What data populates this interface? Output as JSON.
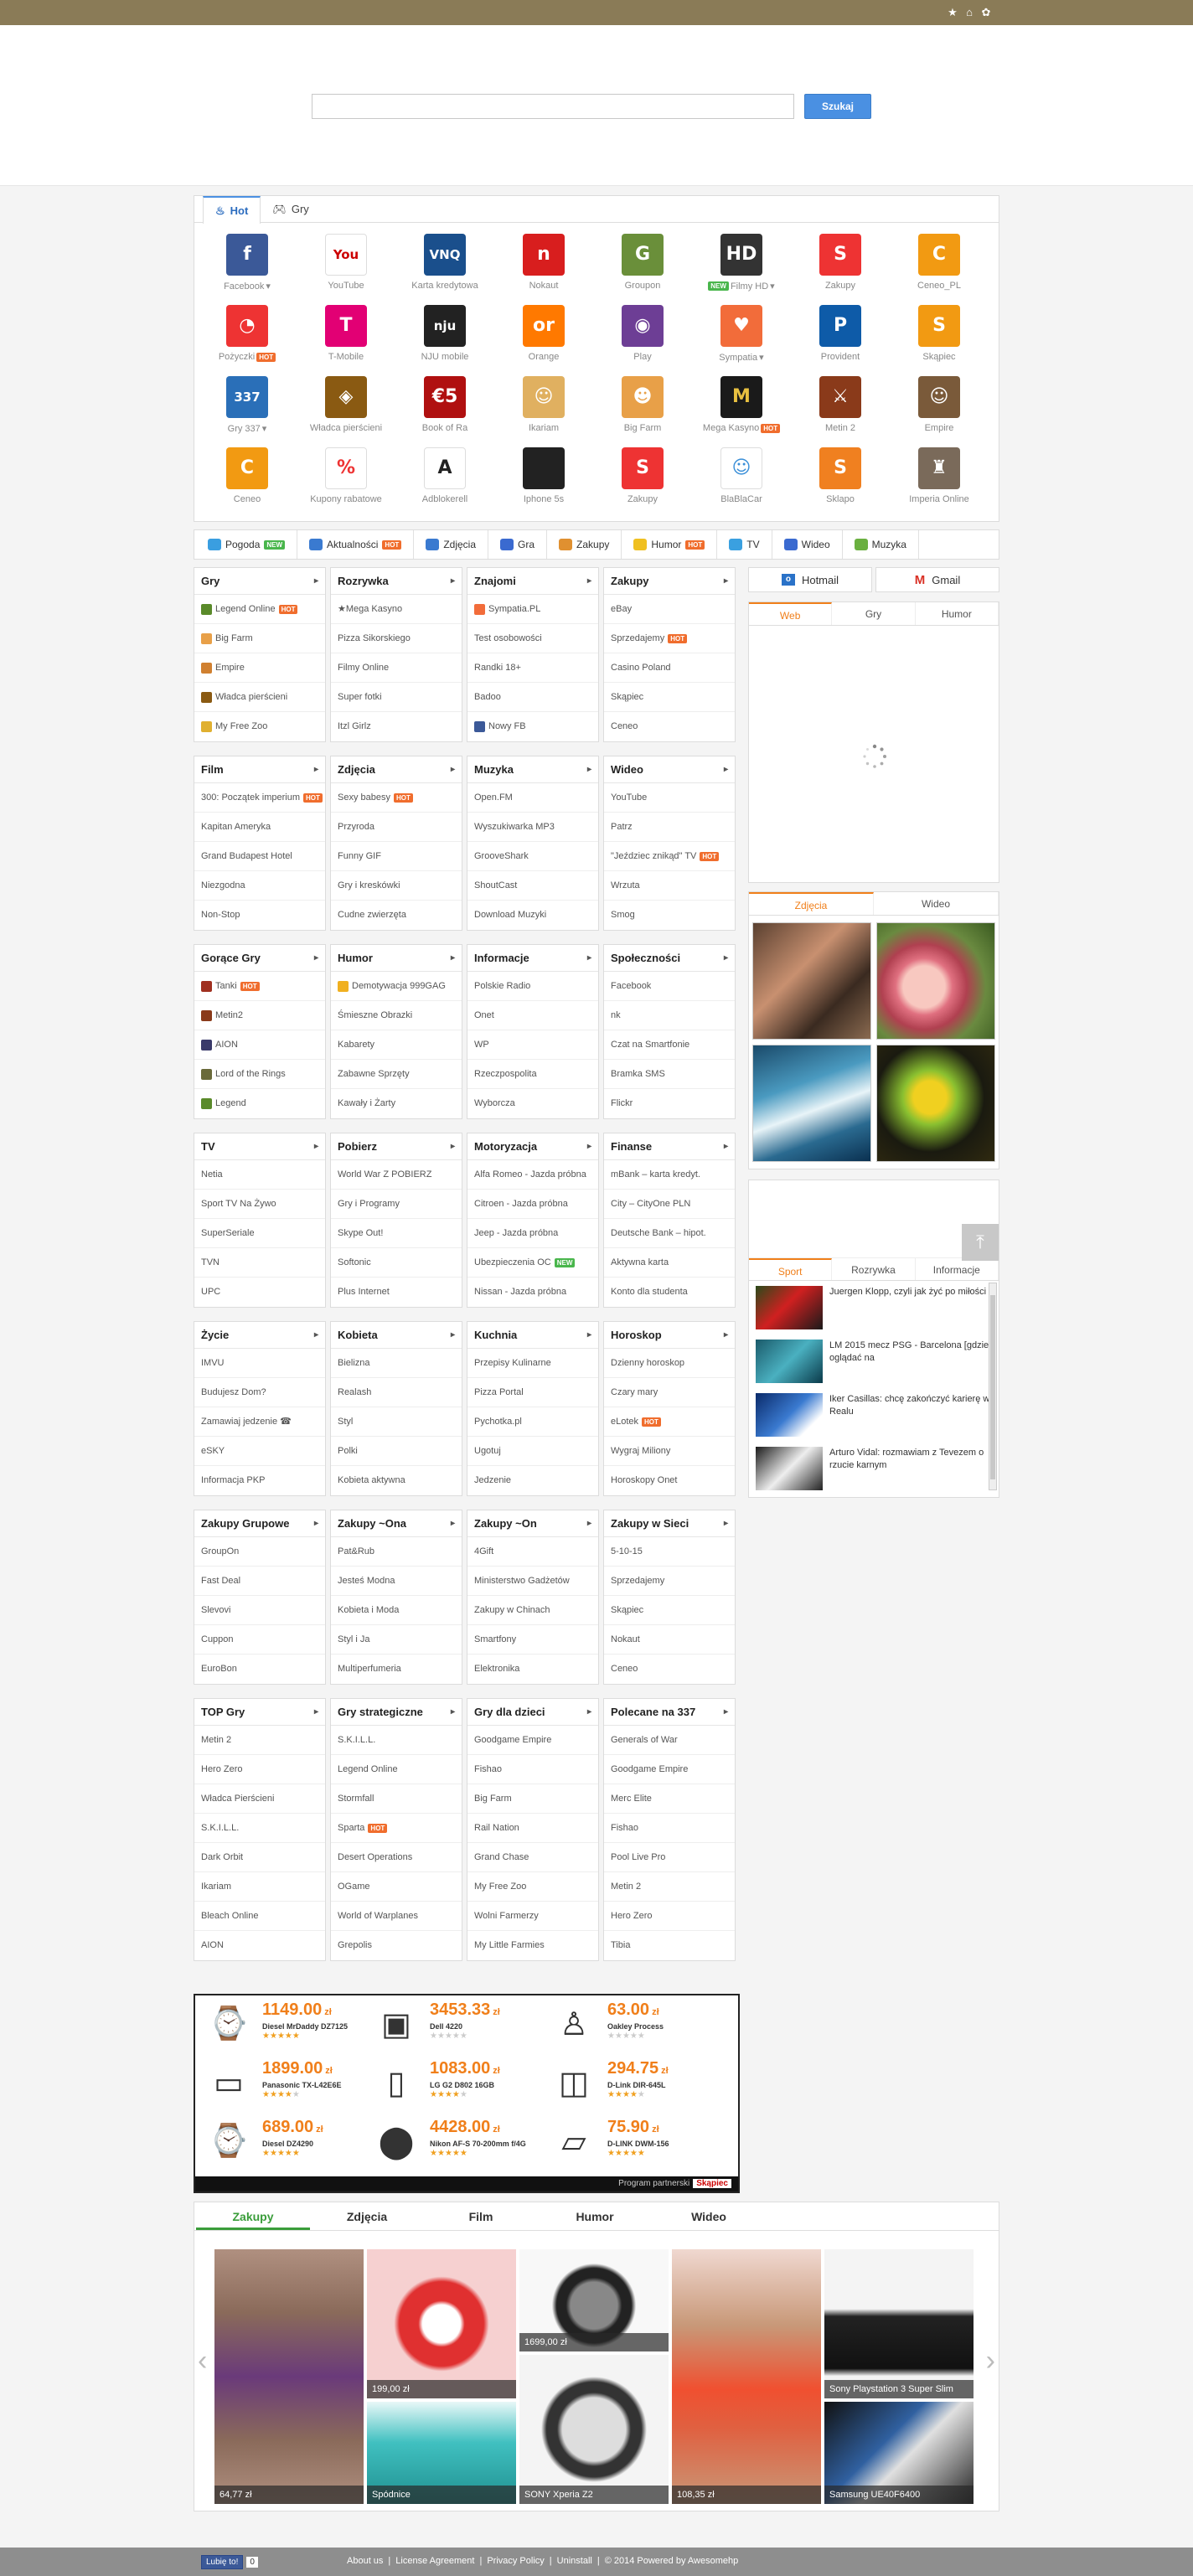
{
  "search": {
    "placeholder": "",
    "button": "Szukaj"
  },
  "icon_tabs": [
    {
      "label": "Hot",
      "icon": "flame-icon"
    },
    {
      "label": "Gry",
      "icon": "gamepad-icon"
    }
  ],
  "icons": [
    {
      "label": "Facebook",
      "caret": true,
      "bg": "#3b5998",
      "glyph": "f"
    },
    {
      "label": "YouTube",
      "bg": "#fff",
      "glyph": "You",
      "fg": "#c00"
    },
    {
      "label": "Karta kredytowa",
      "bg": "#1a4f8c",
      "glyph": "VNQ"
    },
    {
      "label": "Nokaut",
      "bg": "#d81e1e",
      "glyph": "n"
    },
    {
      "label": "Groupon",
      "bg": "#6a8f3a",
      "glyph": "G"
    },
    {
      "label": "Filmy HD",
      "caret": true,
      "badge": "new",
      "bg": "#333",
      "glyph": "HD"
    },
    {
      "label": "Zakupy",
      "bg": "#e33",
      "glyph": "S"
    },
    {
      "label": "Ceneo_PL",
      "bg": "#f29a12",
      "glyph": "C"
    },
    {
      "label": "Pożyczki",
      "badge": "hot",
      "bg": "#e33",
      "glyph": "◔"
    },
    {
      "label": "T-Mobile",
      "bg": "#e20074",
      "glyph": "T"
    },
    {
      "label": "NJU mobile",
      "bg": "#222",
      "glyph": "nju"
    },
    {
      "label": "Orange",
      "bg": "#ff7900",
      "glyph": "or"
    },
    {
      "label": "Play",
      "bg": "#6d3e95",
      "glyph": "◉"
    },
    {
      "label": "Sympatia",
      "caret": true,
      "bg": "#f26c3a",
      "glyph": "♥"
    },
    {
      "label": "Provident",
      "bg": "#0e5ba8",
      "glyph": "P"
    },
    {
      "label": "Skąpiec",
      "bg": "#f29a12",
      "glyph": "S"
    },
    {
      "label": "Gry 337",
      "caret": true,
      "bg": "#2a6fb8",
      "glyph": "337"
    },
    {
      "label": "Władca pierścieni",
      "bg": "#8a5a12",
      "glyph": "◈"
    },
    {
      "label": "Book of Ra",
      "bg": "#b01010",
      "glyph": "€5"
    },
    {
      "label": "Ikariam",
      "bg": "#e0b060",
      "glyph": "☺"
    },
    {
      "label": "Big Farm",
      "bg": "#e8a048",
      "glyph": "☻"
    },
    {
      "label": "Mega Kasyno",
      "badge": "hot",
      "bg": "#1a1a1a",
      "glyph": "M",
      "fg": "#e8c040"
    },
    {
      "label": "Metin 2",
      "bg": "#8a3a1a",
      "glyph": "⚔"
    },
    {
      "label": "Empire",
      "bg": "#7a5a3a",
      "glyph": "☺"
    },
    {
      "label": "Ceneo",
      "bg": "#f29a12",
      "glyph": "C"
    },
    {
      "label": "Kupony rabatowe",
      "bg": "#fff",
      "glyph": "%",
      "fg": "#e33"
    },
    {
      "label": "Adblokerell",
      "bg": "#fff",
      "glyph": "A",
      "fg": "#222"
    },
    {
      "label": "Iphone 5s",
      "bg": "#222",
      "glyph": ""
    },
    {
      "label": "Zakupy",
      "bg": "#e33",
      "glyph": "S"
    },
    {
      "label": "BlaBlaCar",
      "bg": "#fff",
      "glyph": "☺",
      "fg": "#3a8fd8"
    },
    {
      "label": "Sklapo",
      "bg": "#f08020",
      "glyph": "S"
    },
    {
      "label": "Imperia Online",
      "bg": "#7a6a5a",
      "glyph": "♜"
    }
  ],
  "cat_tabs": [
    {
      "label": "Pogoda",
      "badge": "new",
      "icon": "weather-icon",
      "color": "#3a9ee0"
    },
    {
      "label": "Aktualności",
      "badge": "hot",
      "icon": "news-icon",
      "color": "#3a7ad0"
    },
    {
      "label": "Zdjęcia",
      "icon": "photo-icon",
      "color": "#3a7ad0"
    },
    {
      "label": "Gra",
      "icon": "gamepad-icon",
      "color": "#3a6ad0"
    },
    {
      "label": "Zakupy",
      "icon": "cart-icon",
      "color": "#e09030"
    },
    {
      "label": "Humor",
      "badge": "hot",
      "icon": "smiley-icon",
      "color": "#f0c020"
    },
    {
      "label": "TV",
      "icon": "tv-icon",
      "color": "#3aa0e0"
    },
    {
      "label": "Wideo",
      "icon": "video-icon",
      "color": "#3a6ad0"
    },
    {
      "label": "Muzyka",
      "icon": "music-icon",
      "color": "#6ab040"
    }
  ],
  "boxes": [
    {
      "title": "Gry",
      "items": [
        {
          "t": "Legend Online",
          "badge": "hot",
          "ic": "#5a8a2a"
        },
        {
          "t": "Big Farm",
          "ic": "#e8a048"
        },
        {
          "t": "Empire",
          "ic": "#d08030"
        },
        {
          "t": "Władca pierścieni",
          "ic": "#8a5a12"
        },
        {
          "t": "My Free Zoo",
          "ic": "#e0b030"
        }
      ]
    },
    {
      "title": "Rozrywka",
      "items": [
        {
          "t": "★Mega Kasyno"
        },
        {
          "t": "Pizza Sikorskiego"
        },
        {
          "t": "Filmy Online"
        },
        {
          "t": "Super fotki"
        },
        {
          "t": "Itzl Girlz"
        }
      ]
    },
    {
      "title": "Znajomi",
      "items": [
        {
          "t": "Sympatia.PL",
          "ic": "#f26c3a"
        },
        {
          "t": "Test osobowości"
        },
        {
          "t": "Randki 18+"
        },
        {
          "t": "Badoo"
        },
        {
          "t": "Nowy FB",
          "ic": "#3b5998"
        }
      ]
    },
    {
      "title": "Zakupy",
      "items": [
        {
          "t": "eBay"
        },
        {
          "t": "Sprzedajemy",
          "badge": "hot"
        },
        {
          "t": "Casino Poland"
        },
        {
          "t": "Skąpiec"
        },
        {
          "t": "Ceneo"
        }
      ]
    },
    {
      "title": "Film",
      "items": [
        {
          "t": "300: Początek imperium",
          "badge": "hot"
        },
        {
          "t": "Kapitan Ameryka"
        },
        {
          "t": "Grand Budapest Hotel"
        },
        {
          "t": "Niezgodna"
        },
        {
          "t": "Non-Stop"
        }
      ]
    },
    {
      "title": "Zdjęcia",
      "items": [
        {
          "t": "Sexy babesy",
          "badge": "hot"
        },
        {
          "t": "Przyroda"
        },
        {
          "t": "Funny GIF"
        },
        {
          "t": "Gry i kreskówki"
        },
        {
          "t": "Cudne zwierzęta"
        }
      ]
    },
    {
      "title": "Muzyka",
      "items": [
        {
          "t": "Open.FM"
        },
        {
          "t": "Wyszukiwarka MP3"
        },
        {
          "t": "GrooveShark"
        },
        {
          "t": "ShoutCast"
        },
        {
          "t": "Download Muzyki"
        }
      ]
    },
    {
      "title": "Wideo",
      "items": [
        {
          "t": "YouTube"
        },
        {
          "t": "Patrz"
        },
        {
          "t": "\"Jeździec znikąd\" TV",
          "badge": "hot"
        },
        {
          "t": "Wrzuta"
        },
        {
          "t": "Smog"
        }
      ]
    },
    {
      "title": "Gorące Gry",
      "items": [
        {
          "t": "Tanki",
          "badge": "hot",
          "ic": "#a03020"
        },
        {
          "t": "Metin2",
          "ic": "#8a3a1a"
        },
        {
          "t": "AION",
          "ic": "#3a3a6a"
        },
        {
          "t": "Lord of the Rings",
          "ic": "#6a6a3a"
        },
        {
          "t": "Legend",
          "ic": "#5a8a2a"
        }
      ]
    },
    {
      "title": "Humor",
      "items": [
        {
          "t": "Demotywacja 999GAG",
          "ic": "#f0b020"
        },
        {
          "t": "Śmieszne Obrazki"
        },
        {
          "t": "Kabarety"
        },
        {
          "t": "Zabawne Sprzęty"
        },
        {
          "t": "Kawały i Żarty"
        }
      ]
    },
    {
      "title": "Informacje",
      "items": [
        {
          "t": "Polskie Radio"
        },
        {
          "t": "Onet"
        },
        {
          "t": "WP"
        },
        {
          "t": "Rzeczpospolita"
        },
        {
          "t": "Wyborcza"
        }
      ]
    },
    {
      "title": "Społeczności",
      "items": [
        {
          "t": "Facebook"
        },
        {
          "t": "nk"
        },
        {
          "t": "Czat na Smartfonie"
        },
        {
          "t": "Bramka SMS"
        },
        {
          "t": "Flickr"
        }
      ]
    },
    {
      "title": "TV",
      "items": [
        {
          "t": "Netia"
        },
        {
          "t": "Sport TV Na Żywo"
        },
        {
          "t": "SuperSeriale"
        },
        {
          "t": "TVN"
        },
        {
          "t": "UPC"
        }
      ]
    },
    {
      "title": "Pobierz",
      "items": [
        {
          "t": "World War Z POBIERZ"
        },
        {
          "t": "Gry i Programy"
        },
        {
          "t": "Skype Out!"
        },
        {
          "t": "Softonic"
        },
        {
          "t": "Plus Internet"
        }
      ]
    },
    {
      "title": "Motoryzacja",
      "items": [
        {
          "t": "Alfa Romeo - Jazda próbna"
        },
        {
          "t": "Citroen - Jazda próbna"
        },
        {
          "t": "Jeep - Jazda próbna"
        },
        {
          "t": "Ubezpieczenia OC",
          "badge": "new"
        },
        {
          "t": "Nissan - Jazda próbna"
        }
      ]
    },
    {
      "title": "Finanse",
      "items": [
        {
          "t": "mBank – karta kredyt."
        },
        {
          "t": "City – CityOne PLN"
        },
        {
          "t": "Deutsche Bank – hipot."
        },
        {
          "t": "Aktywna karta"
        },
        {
          "t": "Konto dla studenta"
        }
      ]
    },
    {
      "title": "Życie",
      "items": [
        {
          "t": "IMVU"
        },
        {
          "t": "Budujesz Dom?"
        },
        {
          "t": "Zamawiaj jedzenie ☎"
        },
        {
          "t": "eSKY"
        },
        {
          "t": "Informacja PKP"
        }
      ]
    },
    {
      "title": "Kobieta",
      "items": [
        {
          "t": "Bielizna"
        },
        {
          "t": "Realash"
        },
        {
          "t": "Styl"
        },
        {
          "t": "Polki"
        },
        {
          "t": "Kobieta aktywna"
        }
      ]
    },
    {
      "title": "Kuchnia",
      "items": [
        {
          "t": "Przepisy Kulinarne"
        },
        {
          "t": "Pizza Portal"
        },
        {
          "t": "Pychotka.pl"
        },
        {
          "t": "Ugotuj"
        },
        {
          "t": "Jedzenie"
        }
      ]
    },
    {
      "title": "Horoskop",
      "items": [
        {
          "t": "Dzienny horoskop"
        },
        {
          "t": "Czary mary"
        },
        {
          "t": "eLotek",
          "badge": "hot"
        },
        {
          "t": "Wygraj Miliony"
        },
        {
          "t": "Horoskopy Onet"
        }
      ]
    },
    {
      "title": "Zakupy Grupowe",
      "items": [
        {
          "t": "GroupOn"
        },
        {
          "t": "Fast Deal"
        },
        {
          "t": "Slevovi"
        },
        {
          "t": "Cuppon"
        },
        {
          "t": "EuroBon"
        }
      ]
    },
    {
      "title": "Zakupy ~Ona",
      "items": [
        {
          "t": "Pat&Rub"
        },
        {
          "t": "Jesteś Modna"
        },
        {
          "t": "Kobieta i Moda"
        },
        {
          "t": "Styl i Ja"
        },
        {
          "t": "Multiperfumeria"
        }
      ]
    },
    {
      "title": "Zakupy ~On",
      "items": [
        {
          "t": "4Gift"
        },
        {
          "t": "Ministerstwo Gadżetów"
        },
        {
          "t": "Zakupy w Chinach"
        },
        {
          "t": "Smartfony"
        },
        {
          "t": "Elektronika"
        }
      ]
    },
    {
      "title": "Zakupy w Sieci",
      "items": [
        {
          "t": "5-10-15"
        },
        {
          "t": "Sprzedajemy"
        },
        {
          "t": "Skąpiec"
        },
        {
          "t": "Nokaut"
        },
        {
          "t": "Ceneo"
        }
      ]
    },
    {
      "title": "TOP Gry",
      "items": [
        {
          "t": "Metin 2"
        },
        {
          "t": "Hero Zero"
        },
        {
          "t": "Władca Pierścieni"
        },
        {
          "t": "S.K.I.L.L."
        },
        {
          "t": "Dark Orbit"
        },
        {
          "t": "Ikariam"
        },
        {
          "t": "Bleach Online"
        },
        {
          "t": "AION"
        }
      ]
    },
    {
      "title": "Gry strategiczne",
      "items": [
        {
          "t": "S.K.I.L.L."
        },
        {
          "t": "Legend Online"
        },
        {
          "t": "Stormfall"
        },
        {
          "t": "Sparta",
          "badge": "hot"
        },
        {
          "t": "Desert Operations"
        },
        {
          "t": "OGame"
        },
        {
          "t": "World of Warplanes"
        },
        {
          "t": "Grepolis"
        }
      ]
    },
    {
      "title": "Gry dla dzieci",
      "items": [
        {
          "t": "Goodgame Empire"
        },
        {
          "t": "Fishao"
        },
        {
          "t": "Big Farm"
        },
        {
          "t": "Rail Nation"
        },
        {
          "t": "Grand Chase"
        },
        {
          "t": "My Free Zoo"
        },
        {
          "t": "Wolni Farmerzy"
        },
        {
          "t": "My Little Farmies"
        }
      ]
    },
    {
      "title": "Polecane na 337",
      "items": [
        {
          "t": "Generals of War"
        },
        {
          "t": "Goodgame Empire"
        },
        {
          "t": "Merc Elite"
        },
        {
          "t": "Fishao"
        },
        {
          "t": "Pool Live Pro"
        },
        {
          "t": "Metin 2"
        },
        {
          "t": "Hero Zero"
        },
        {
          "t": "Tibia"
        }
      ]
    }
  ],
  "mail": [
    {
      "label": "Hotmail",
      "icon": "outlook-icon"
    },
    {
      "label": "Gmail",
      "icon": "gmail-icon"
    }
  ],
  "web_tabs": [
    "Web",
    "Gry",
    "Humor"
  ],
  "photo_tabs": [
    "Zdjęcia",
    "Wideo"
  ],
  "news_tabs": [
    "Sport",
    "Rozrywka",
    "Informacje"
  ],
  "news": [
    {
      "text": "Juergen Klopp, czyli jak żyć po miłości"
    },
    {
      "text": "LM 2015 mecz PSG - Barcelona [gdzie oglądać na"
    },
    {
      "text": "Iker Casillas: chcę zakończyć karierę w Realu"
    },
    {
      "text": "Arturo Vidal: rozmawiam z Tevezem o rzucie karnym"
    }
  ],
  "ad": {
    "currency": "zł",
    "products": [
      {
        "price": "1149.00",
        "name": "Diesel MrDaddy DZ7125",
        "rating": 5
      },
      {
        "price": "3453.33",
        "name": "Dell 4220",
        "rating": 0
      },
      {
        "price": "63.00",
        "name": "Oakley Process",
        "rating": 0
      },
      {
        "price": "1899.00",
        "name": "Panasonic TX-L42E6E",
        "rating": 4
      },
      {
        "price": "1083.00",
        "name": "LG G2 D802 16GB",
        "rating": 4
      },
      {
        "price": "294.75",
        "name": "D-Link DIR-645L",
        "rating": 4
      },
      {
        "price": "689.00",
        "name": "Diesel DZ4290",
        "rating": 5
      },
      {
        "price": "4428.00",
        "name": "Nikon AF-S 70-200mm f/4G",
        "rating": 5
      },
      {
        "price": "75.90",
        "name": "D-LINK DWM-156",
        "rating": 5
      }
    ],
    "partner_label": "Program partnerski",
    "partner_name": "Skąpiec"
  },
  "carousel": {
    "tabs": [
      "Zakupy",
      "Zdjęcia",
      "Film",
      "Humor",
      "Wideo"
    ],
    "items": [
      {
        "caption": "64,77 zł"
      },
      {
        "caption": "199,00 zł"
      },
      {
        "caption": "Spódnice"
      },
      {
        "caption": "1699,00 zł"
      },
      {
        "caption": "SONY Xperia Z2"
      },
      {
        "caption": "108,35 zł"
      },
      {
        "caption": "Sony Playstation 3 Super Slim"
      },
      {
        "caption": "Samsung UE40F6400"
      }
    ]
  },
  "footer": {
    "like": "Lubię to!",
    "like_count": "0",
    "links": [
      "About us",
      "License Agreement",
      "Privacy Policy",
      "Uninstall"
    ],
    "copyright": "© 2014 Powered by Awesomehp"
  }
}
